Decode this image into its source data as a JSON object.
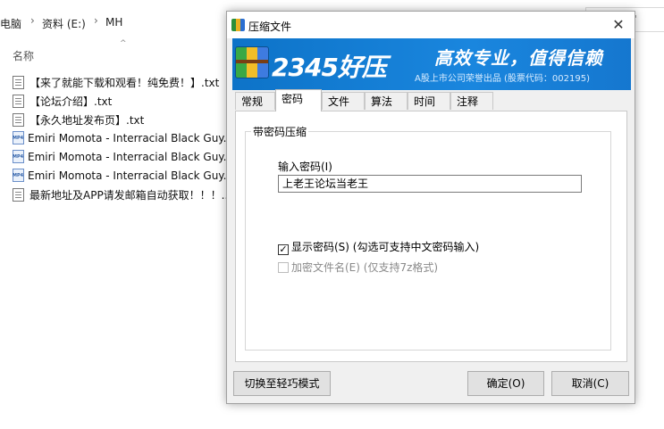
{
  "explorer": {
    "breadcrumb": [
      "电脑",
      "资料 (E:)",
      "MH"
    ],
    "search_hint": "\"",
    "column_name": "名称",
    "files": [
      {
        "name": "【来了就能下载和观看！纯免费！】.txt",
        "icon": "txt-file-icon"
      },
      {
        "name": "【论坛介绍】.txt",
        "icon": "txt-file-icon"
      },
      {
        "name": "【永久地址发布页】.txt",
        "icon": "txt-file-icon"
      },
      {
        "name": "Emiri Momota - Interracial Black Guy...",
        "icon": "mp4-file-icon"
      },
      {
        "name": "Emiri Momota - Interracial Black Guy...",
        "icon": "mp4-file-icon"
      },
      {
        "name": "Emiri Momota - Interracial Black Guy...",
        "icon": "mp4-file-icon"
      },
      {
        "name": "最新地址及APP请发邮箱自动获取！！！...",
        "icon": "txt-file-icon"
      }
    ]
  },
  "dialog": {
    "title": "压缩文件",
    "close_glyph": "✕",
    "banner": {
      "brand": "2345好压",
      "slogan": "高效专业，值得信赖",
      "sub": "A股上市公司荣誉出品 (股票代码：002195)",
      "bg_color": "#1580d6"
    },
    "tabs": [
      "常规",
      "密码",
      "文件",
      "算法",
      "时间",
      "注释"
    ],
    "active_tab": "密码",
    "group_title": "带密码压缩",
    "password_label": "输入密码(I)",
    "password_value": "上老王论坛当老王",
    "show_password": {
      "label": "显示密码(S)  (勾选可支持中文密码输入)",
      "checked": true
    },
    "encrypt_names": {
      "label": "加密文件名(E)  (仅支持7z格式)",
      "checked": false,
      "disabled": true
    },
    "buttons": {
      "simple_mode": "切换至轻巧模式",
      "ok": "确定(O)",
      "cancel": "取消(C)"
    }
  }
}
